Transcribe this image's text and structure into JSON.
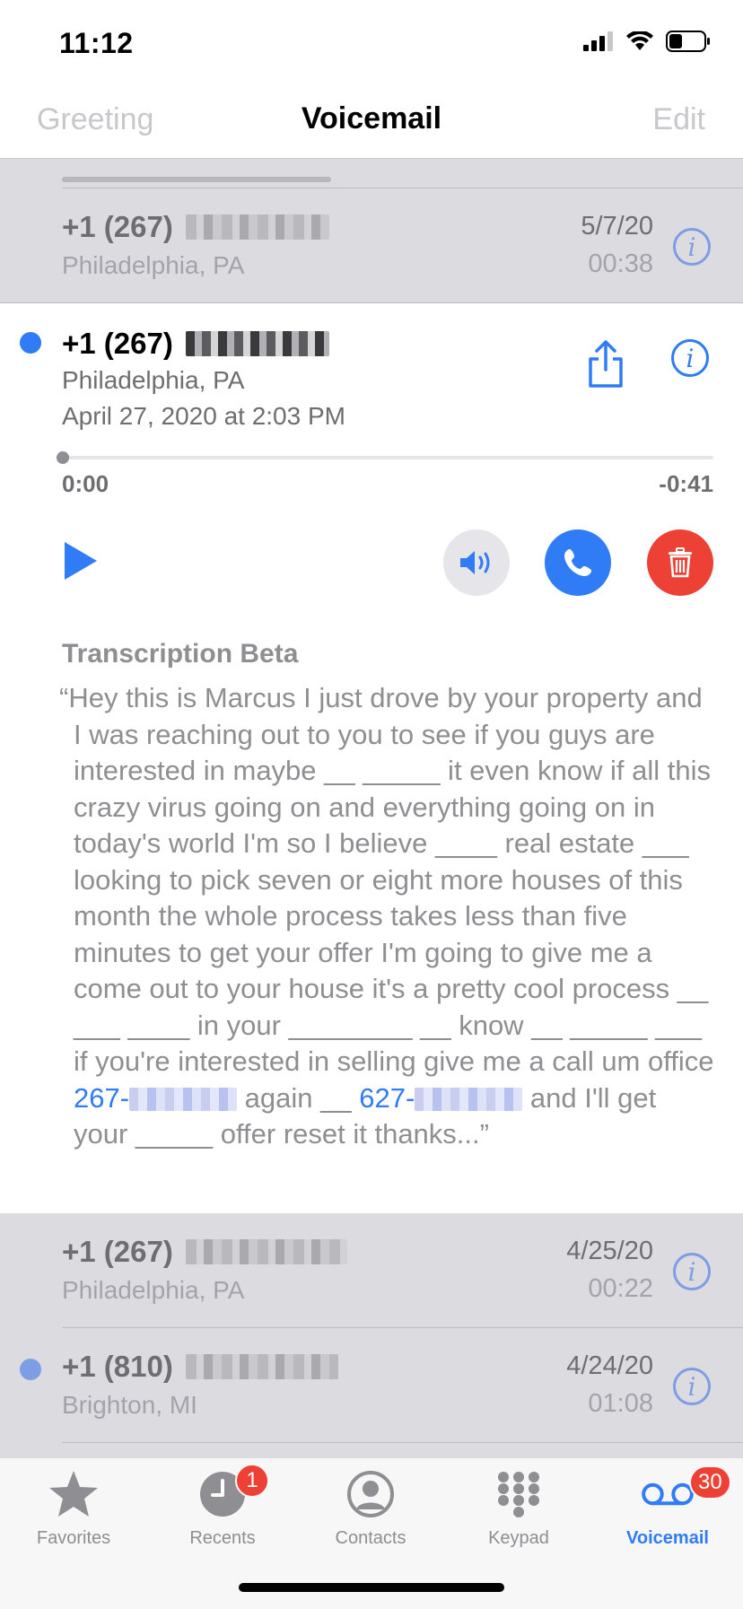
{
  "status_bar": {
    "time": "11:12"
  },
  "nav": {
    "greeting": "Greeting",
    "title": "Voicemail",
    "edit": "Edit"
  },
  "voicemails": [
    {
      "number": "+1 (267)",
      "location": "Philadelphia, PA",
      "date": "5/7/20",
      "duration": "00:38"
    },
    {
      "number": "+1 (267)",
      "location": "Philadelphia, PA",
      "date": "4/25/20",
      "duration": "00:22"
    },
    {
      "number": "+1 (810)",
      "location": "Brighton, MI",
      "date": "4/24/20",
      "duration": "01:08",
      "unread": true
    }
  ],
  "expanded": {
    "number": "+1 (267)",
    "location": "Philadelphia, PA",
    "datetime": "April 27, 2020 at 2:03 PM",
    "elapsed": "0:00",
    "remaining": "-0:41",
    "progress": 0.0,
    "transcription_heading": "Transcription Beta",
    "transcription_part1": "“Hey this is Marcus I just drove by your property and I was reaching out to you to see if you guys are interested in maybe __ _____ it even know if all this crazy virus going on and everything going on in today's world I'm so I believe ____ real estate ___ looking to pick seven or eight more houses of this month the whole process takes less than five minutes to get your offer I'm going to give me a come out to your house it's a pretty cool process __ ___ ____ in your ________ __ know __ _____ ___ if you're interested in selling give me a call um office ",
    "link1": "267-",
    "transcription_part2": " again __ ",
    "link2": "627-",
    "transcription_part3": " and I'll get your _____ offer reset it thanks...”"
  },
  "tabs": [
    {
      "label": "Favorites",
      "icon": "star-icon"
    },
    {
      "label": "Recents",
      "icon": "clock-icon",
      "badge": "1"
    },
    {
      "label": "Contacts",
      "icon": "person-circle-icon"
    },
    {
      "label": "Keypad",
      "icon": "keypad-icon"
    },
    {
      "label": "Voicemail",
      "icon": "voicemail-icon",
      "badge": "30",
      "active": true
    }
  ],
  "colors": {
    "accent": "#2f7cf6",
    "delete": "#ec4134",
    "dim_overlay": "#dcdce0"
  }
}
